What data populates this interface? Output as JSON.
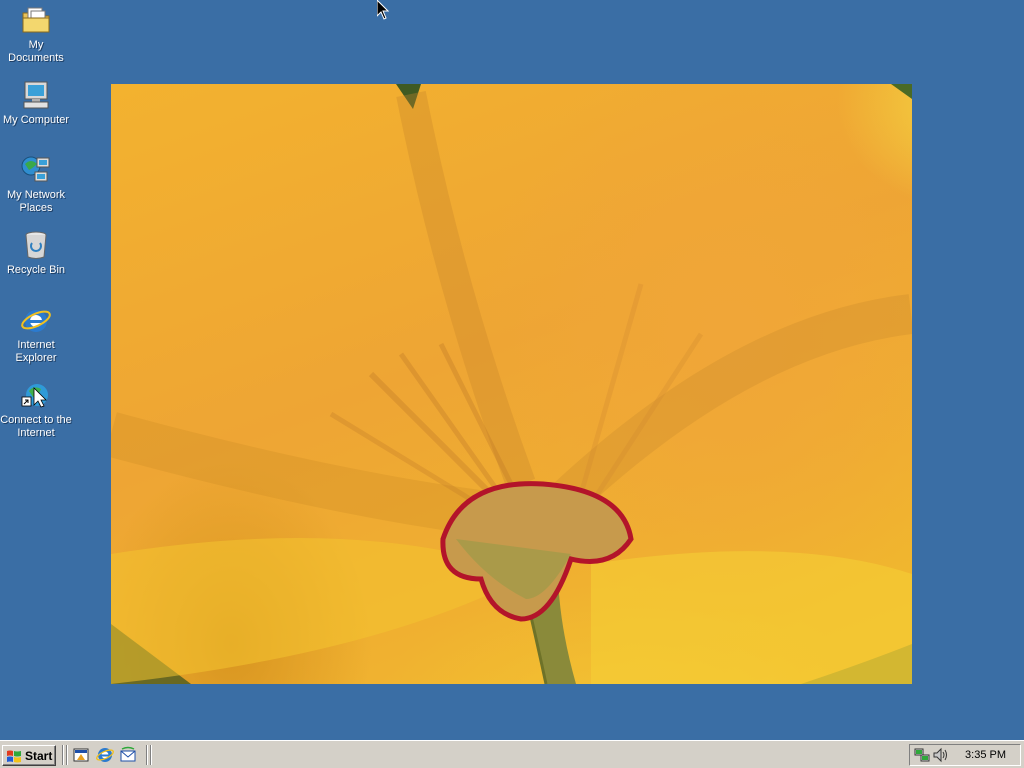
{
  "desktop": {
    "background_color": "#3A6EA5",
    "icons": [
      {
        "label": "My Documents",
        "icon": "folder-documents-icon"
      },
      {
        "label": "My Computer",
        "icon": "computer-icon"
      },
      {
        "label": "My Network Places",
        "icon": "network-places-icon"
      },
      {
        "label": "Recycle Bin",
        "icon": "recycle-bin-icon"
      },
      {
        "label": "Internet Explorer",
        "icon": "internet-explorer-icon"
      },
      {
        "label": "Connect to the Internet",
        "icon": "connect-internet-icon"
      }
    ],
    "wallpaper": {
      "subject": "flower-wallpaper"
    }
  },
  "taskbar": {
    "start_label": "Start",
    "quick_launch": [
      {
        "icon": "show-desktop-icon"
      },
      {
        "icon": "internet-explorer-icon"
      },
      {
        "icon": "outlook-express-icon"
      }
    ],
    "tray": {
      "icons": [
        "network-tray-icon",
        "volume-tray-icon"
      ],
      "clock": "3:35 PM"
    }
  }
}
